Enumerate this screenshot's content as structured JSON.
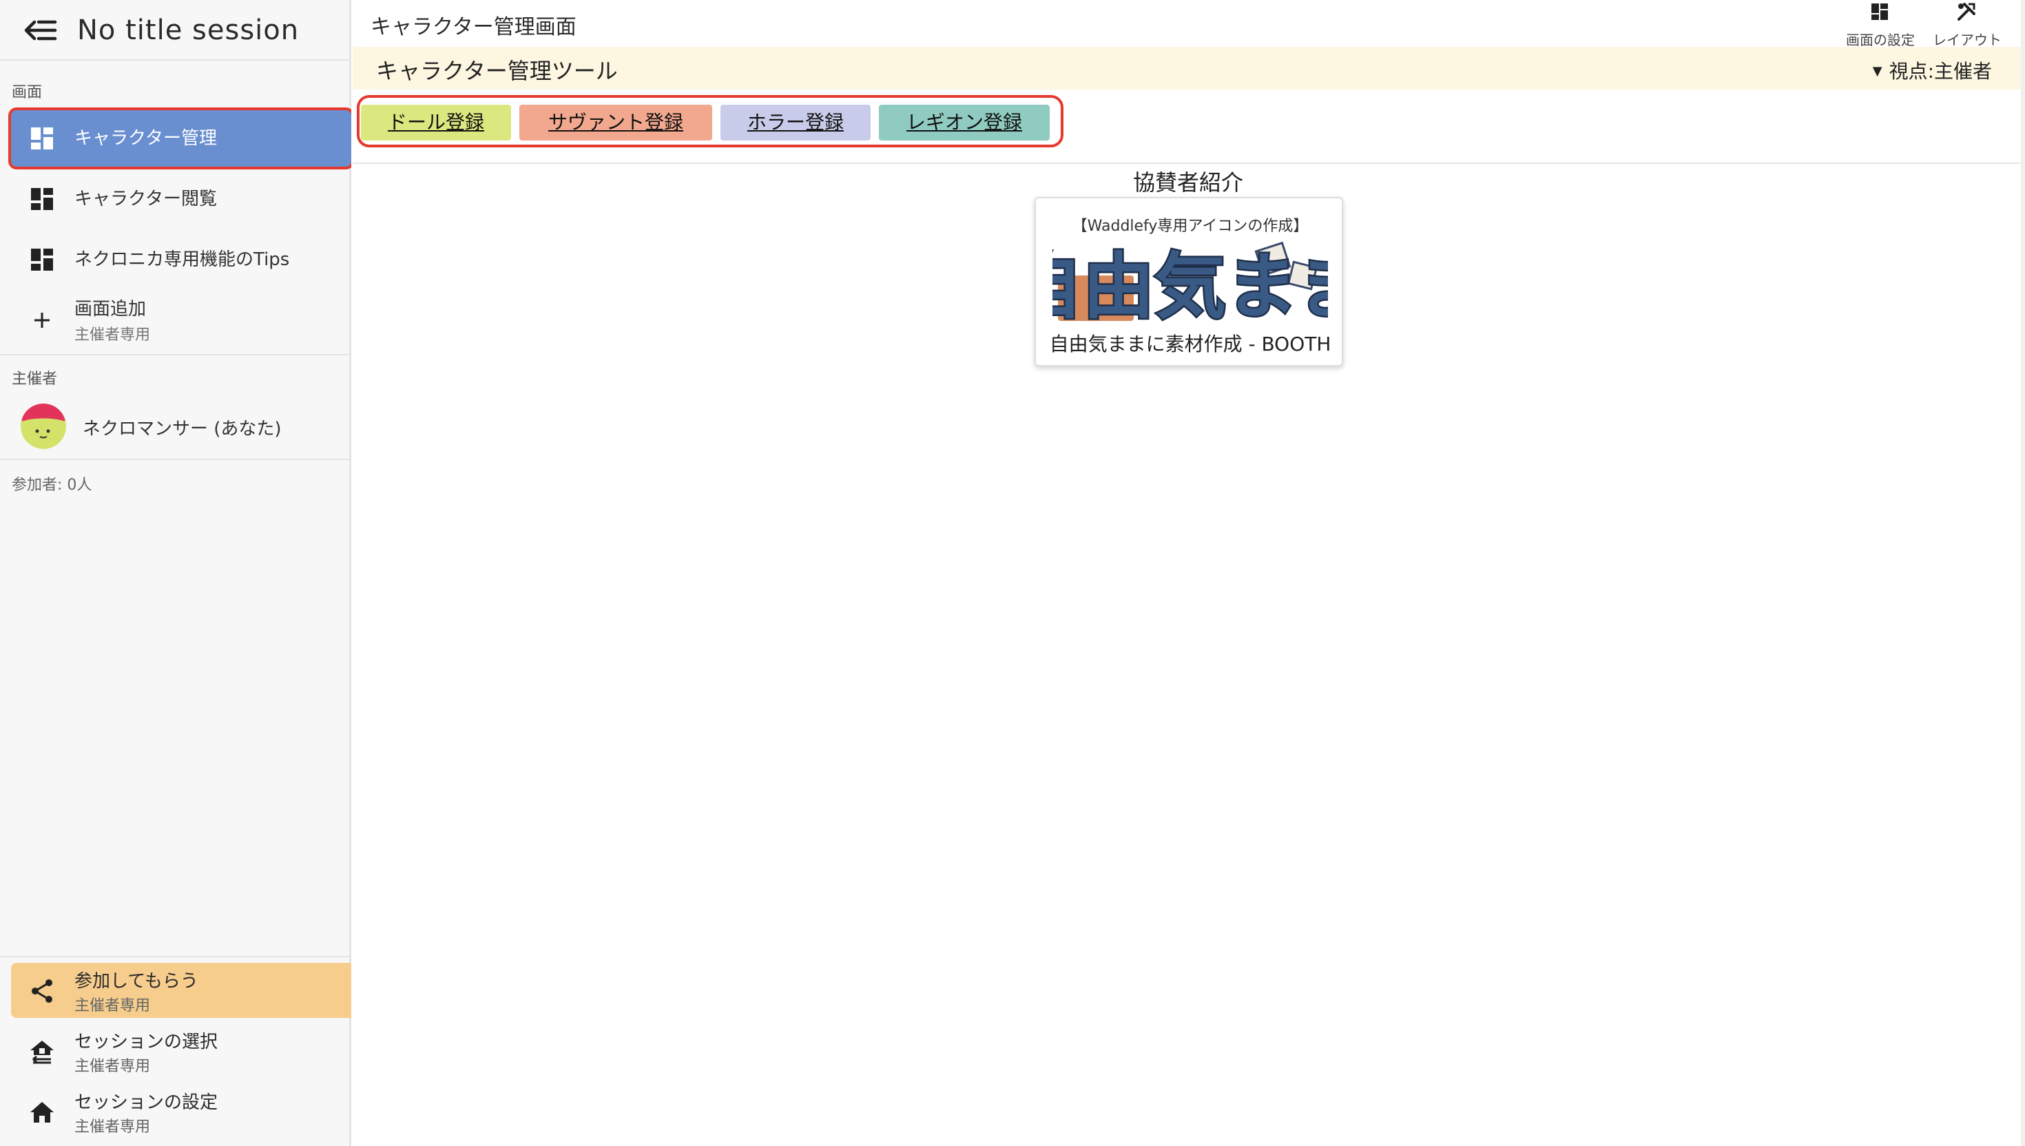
{
  "sidebar": {
    "session_title": "No title session",
    "screens_label": "画面",
    "items": [
      {
        "label": "キャラクター管理",
        "active": true
      },
      {
        "label": "キャラクター閲覧",
        "active": false
      },
      {
        "label": "ネクロニカ専用機能のTips",
        "active": false
      }
    ],
    "add_screen": {
      "label": "画面追加",
      "sub": "主催者専用"
    },
    "host_label": "主催者",
    "host_name": "ネクロマンサー (あなた)",
    "participants": "参加者: 0人",
    "bottom": [
      {
        "label": "参加してもらう",
        "sub": "主催者専用",
        "icon": "share-icon"
      },
      {
        "label": "セッションの選択",
        "sub": "主催者専用",
        "icon": "house-switch-icon"
      },
      {
        "label": "セッションの設定",
        "sub": "主催者専用",
        "icon": "home-icon"
      }
    ]
  },
  "main": {
    "screen_title": "キャラクター管理画面",
    "top_buttons": [
      {
        "label": "画面の設定",
        "icon": "dashboard-icon"
      },
      {
        "label": "レイアウト",
        "icon": "tools-icon"
      }
    ],
    "tool_title": "キャラクター管理ツール",
    "viewpoint": "視点:主催者",
    "register_buttons": [
      {
        "label": "ドール登録",
        "color": "#dbe87f"
      },
      {
        "label": "サヴァント登録",
        "color": "#f2a88e"
      },
      {
        "label": "ホラー登録",
        "color": "#c9cbea"
      },
      {
        "label": "レギオン登録",
        "color": "#8fcbc0"
      }
    ],
    "sponsor_heading": "協賛者紹介",
    "sponsor": {
      "top_text": "【Waddlefy専用アイコンの作成】",
      "logo_text": "自由気まま",
      "bottom_text": "自由気ままに素材作成 - BOOTH"
    }
  },
  "colors": {
    "active_nav": "#6a8fd0",
    "highlight_bottom": "#f6cd8c",
    "tool_bar_bg": "#fdf7e2",
    "emphasis_outline": "#e53a2d"
  }
}
